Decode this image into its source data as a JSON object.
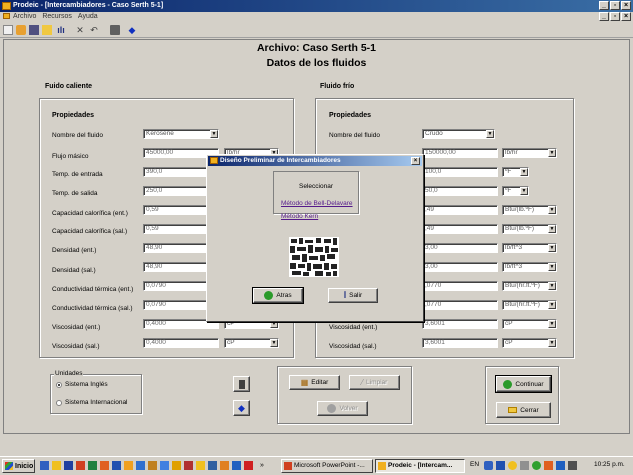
{
  "window": {
    "title": "Prodeic - [Intercambiadores - Caso Serth 5-1]"
  },
  "menu": [
    "Archivo",
    "Recursos",
    "Ayuda"
  ],
  "header": {
    "file_line": "Archivo:  Caso Serth 5-1",
    "subtitle": "Datos de los fluidos"
  },
  "hot": {
    "section": "Fuido caliente",
    "props_title": "Propiedades",
    "labels": [
      "Nombre del fluido",
      "Flujo másico",
      "Temp. de entrada",
      "Temp. de salida",
      "Capacidad calorífica (ent.)",
      "Capacidad calorífica (sal.)",
      "Densidad (ent.)",
      "Densidad (sal.)",
      "Conductividad térmica (ent.)",
      "Conductividad térmica (sal.)",
      "Viscosidad (ent.)",
      "Viscosidad (sal.)"
    ],
    "fluid_name": "Kerosene",
    "values": [
      "45000,00",
      "390,0",
      "250,0",
      "0,59",
      "0,59",
      "48,90",
      "48,90",
      "0,0790",
      "0,0790",
      "0,4000",
      "0,4000"
    ],
    "units": [
      "lb/hr",
      "",
      "",
      "",
      "",
      "",
      "",
      "",
      "",
      "cP",
      "cP"
    ]
  },
  "cold": {
    "section": "Fluido frío",
    "props_title": "Propiedades",
    "labels": [
      "Nombre del fluido",
      "",
      "",
      "",
      "",
      "",
      "",
      "",
      "",
      "",
      "Viscosidad (ent.)",
      "Viscosidad (sal.)"
    ],
    "fluid_name": "Crudo",
    "values": [
      "150000,00",
      "100,0",
      "50,0",
      ",49",
      ",49",
      "3,00",
      "3,00",
      ",0770",
      ",0770",
      "3,6001",
      "3,6001"
    ],
    "units": [
      "lb/hr",
      "ºF",
      "ºF",
      "Btu/(lb.ºF)",
      "Btu/(lb.ºF)",
      "lb/ft^3",
      "lb/ft^3",
      "Btu/(hr.ft.ºF)",
      "Btu/(hr.ft.ºF)",
      "cP",
      "cP"
    ]
  },
  "units_group": {
    "title": "Unidades",
    "options": [
      "Sistema Inglés",
      "Sistema Internacional"
    ],
    "selected": 0
  },
  "actions": {
    "edit": "Editar",
    "clear": "Limpiar",
    "back": "Volver",
    "continue": "Continuar",
    "close": "Cerrar"
  },
  "dialog": {
    "title": "Diseño Preliminar de Intercambiadores",
    "prompt": "Seleccionar",
    "methods": [
      "Método de Bell-Delavare",
      "Método Kern"
    ],
    "back": "Atras",
    "exit": "Salir"
  },
  "taskbar": {
    "start": "Inicio",
    "tasks": [
      "Microsoft PowerPoint -...",
      "Prodeic - [Intercam..."
    ],
    "lang": "EN",
    "clock": "10:25 p.m."
  }
}
